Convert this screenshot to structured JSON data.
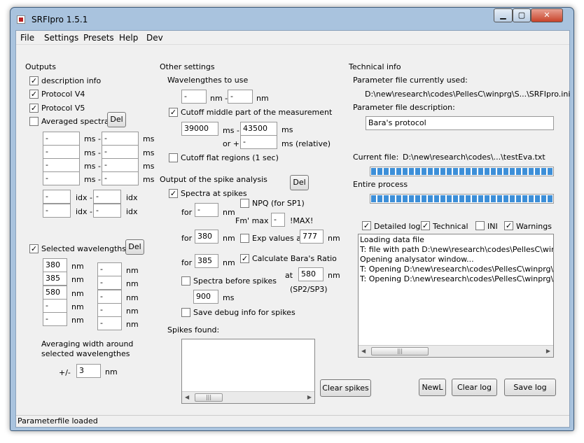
{
  "window": {
    "title": "SRFIpro 1.5.1"
  },
  "menu": [
    "File",
    "Settings",
    "Presets",
    "Help",
    "Dev"
  ],
  "outputs": {
    "title": "Outputs",
    "description_info": "description info",
    "protocol_v4": "Protocol V4",
    "protocol_v5": "Protocol V5",
    "averaged_spectra": "Averaged spectra",
    "del": "Del",
    "ms_rows": [
      [
        "-",
        "-"
      ],
      [
        "-",
        "-"
      ],
      [
        "-",
        "-"
      ],
      [
        "-",
        "-"
      ]
    ],
    "ms_sep": "ms -",
    "ms": "ms",
    "idx_rows": [
      [
        "-",
        "-"
      ],
      [
        "-",
        "-"
      ]
    ],
    "idx_sep": "idx -",
    "idx": "idx"
  },
  "selected_wavelengths": {
    "label": "Selected wavelengths",
    "del": "Del",
    "left": [
      "380",
      "385",
      "580",
      "-",
      "-"
    ],
    "right": [
      "-",
      "-",
      "-",
      "-",
      "-"
    ],
    "nm": "nm",
    "averaging_line1": "Averaging width around",
    "averaging_line2": "selected wavelengthes",
    "pm": "+/-",
    "width": "3"
  },
  "other": {
    "title": "Other settings",
    "wavelengths_to_use": "Wavelengthes to use",
    "wl_from": "-",
    "wl_to": "-",
    "nm_sep": "nm -",
    "nm": "nm",
    "cutoff_middle": "Cutoff middle part of the measurement",
    "cut_from": "39000",
    "cut_to": "43500",
    "ms_sep": "ms -",
    "ms": "ms",
    "or_plus": "or +",
    "cut_rel": "-",
    "ms_relative": "ms (relative)",
    "cutoff_flat": "Cutoff flat regions (1 sec)"
  },
  "spike": {
    "title": "Output of the spike analysis",
    "del": "Del",
    "spectra_at_spikes": "Spectra at spikes",
    "npq": "NPQ (for SP1)",
    "for": "for",
    "for_val": "-",
    "nm": "nm",
    "fm_max": "Fm' max",
    "fm_val": "-",
    "max_note": "!MAX!",
    "for380": "380",
    "exp_values": "Exp values at",
    "exp_val": "777",
    "for385": "385",
    "baras_ratio": "Calculate Bara's Ratio",
    "at": "at",
    "at_val": "580",
    "sp_note": "(SP2/SP3)",
    "spectra_before": "Spectra before spikes",
    "before_ms": "900",
    "ms": "ms",
    "save_debug": "Save debug info for spikes",
    "spikes_found": "Spikes found:",
    "clear_spikes": "Clear spikes"
  },
  "tech": {
    "title": "Technical info",
    "param_used_label": "Parameter file currently used:",
    "param_used_path": "D:\\new\\research\\codes\\PellesC\\winprg\\S...\\SRFIpro.ini",
    "param_desc_label": "Parameter file description:",
    "param_desc_value": "Bara's protocol",
    "current_file_label": "Current file:",
    "current_file_path": "D:\\new\\research\\codes\\...\\testEva.txt",
    "current_progress": 1.0,
    "entire_process": "Entire process",
    "entire_progress": 1.0,
    "detailed_log": "Detailed log",
    "technical": "Technical",
    "ini": "INI",
    "warnings": "Warnings",
    "log": [
      "Loading data file",
      "T: file with path D:\\new\\research\\codes\\PellesC\\winpr",
      "Opening analysator window...",
      "T: Opening D:\\new\\research\\codes\\PellesC\\winprg\\SR",
      "T: Opening D:\\new\\research\\codes\\PellesC\\winprg\\SR"
    ],
    "newl": "NewL",
    "clear_log": "Clear log",
    "save_log": "Save log"
  },
  "status": "Parameterfile loaded",
  "colors": {
    "frame": "#a9c3de",
    "progress": "#3d8fd8",
    "close": "#c8432a"
  }
}
